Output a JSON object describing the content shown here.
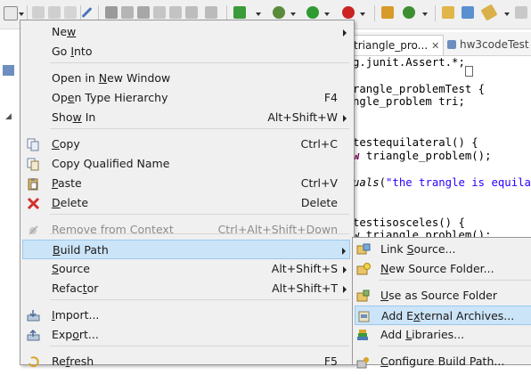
{
  "toolbar": {
    "icons": [
      "new-wizard-icon",
      "save-icon",
      "save-all-icon",
      "print-icon",
      "skip-breakpoints-icon",
      "toggle-breakpoint-icon",
      "step-icon",
      "debug-step-icon",
      "run-step-icon",
      "drop-frame-icon",
      "external-tools-icon",
      "debug-icon",
      "run-icon",
      "run-stop-icon",
      "new-java-package-icon",
      "new-java-class-icon",
      "open-type-icon",
      "search-icon",
      "refactor-icon"
    ]
  },
  "editor": {
    "tabs": [
      {
        "label": "triangle_pro...",
        "close": "✕"
      },
      {
        "label": "hw3codeTest"
      }
    ],
    "code_lines": [
      {
        "parts": [
          {
            "t": "g.junit.Assert.*;",
            "c": ""
          },
          {
            "t": "□",
            "c": ""
          }
        ]
      },
      {
        "parts": [
          {
            "t": "rangle_problemTest {",
            "c": ""
          }
        ]
      },
      {
        "parts": [
          {
            "t": "ngle_problem tri;",
            "c": ""
          }
        ]
      },
      {
        "parts": [
          {
            "t": "testequilateral() {",
            "c": ""
          }
        ]
      },
      {
        "parts": [
          {
            "t": "w ",
            "c": "kw"
          },
          {
            "t": "triangle_problem();",
            "c": ""
          }
        ]
      },
      {
        "parts": [
          {
            "t": "uals",
            "c": "it"
          },
          {
            "t": "(",
            "c": ""
          },
          {
            "t": "\"the trangle is equilate",
            "c": "str"
          }
        ]
      },
      {
        "parts": [
          {
            "t": "testisosceles() {",
            "c": ""
          }
        ]
      },
      {
        "parts": [
          {
            "t": "w triangle_problem();",
            "c": ""
          }
        ]
      }
    ]
  },
  "context_menu": {
    "items": [
      {
        "label": "New",
        "mn": "w",
        "shortcut": "",
        "submenu": true,
        "icon": ""
      },
      {
        "label": "Go Into",
        "mn": "I",
        "shortcut": "",
        "icon": ""
      },
      {
        "label": "Open in New Window",
        "mn": "N",
        "shortcut": "",
        "icon": ""
      },
      {
        "label": "Open Type Hierarchy",
        "mn": "e",
        "shortcut": "F4",
        "icon": ""
      },
      {
        "label": "Show In",
        "mn": "w",
        "shortcut": "Alt+Shift+W",
        "submenu": true,
        "icon": ""
      },
      {
        "label": "Copy",
        "mn": "C",
        "shortcut": "Ctrl+C",
        "icon": "copy-icon"
      },
      {
        "label": "Copy Qualified Name",
        "mn": "",
        "shortcut": "",
        "icon": "copy-qualified-name-icon"
      },
      {
        "label": "Paste",
        "mn": "P",
        "shortcut": "Ctrl+V",
        "icon": "paste-icon"
      },
      {
        "label": "Delete",
        "mn": "D",
        "shortcut": "Delete",
        "icon": "delete-icon"
      },
      {
        "label": "Remove from Context",
        "mn": "",
        "shortcut": "Ctrl+Alt+Shift+Down",
        "disabled": true,
        "icon": "remove-from-context-icon"
      },
      {
        "label": "Build Path",
        "mn": "B",
        "shortcut": "",
        "submenu": true,
        "highlighted": true,
        "icon": ""
      },
      {
        "label": "Source",
        "mn": "S",
        "shortcut": "Alt+Shift+S",
        "submenu": true,
        "icon": ""
      },
      {
        "label": "Refactor",
        "mn": "t",
        "shortcut": "Alt+Shift+T",
        "submenu": true,
        "icon": ""
      },
      {
        "label": "Import...",
        "mn": "I",
        "shortcut": "",
        "icon": "import-icon"
      },
      {
        "label": "Export...",
        "mn": "o",
        "shortcut": "",
        "icon": "export-icon"
      },
      {
        "label": "Refresh",
        "mn": "f",
        "shortcut": "F5",
        "icon": "refresh-icon"
      }
    ]
  },
  "build_path_submenu": {
    "items": [
      {
        "label": "Link Source...",
        "mn": "S",
        "icon": "link-source-icon"
      },
      {
        "label": "New Source Folder...",
        "mn": "N",
        "icon": "new-source-folder-icon"
      },
      {
        "label": "Use as Source Folder",
        "mn": "U",
        "icon": "use-as-source-folder-icon"
      },
      {
        "label": "Add External Archives...",
        "mn": "x",
        "highlighted": true,
        "icon": "add-external-archives-icon"
      },
      {
        "label": "Add Libraries...",
        "mn": "L",
        "icon": "add-libraries-icon"
      },
      {
        "label": "Configure Build Path...",
        "mn": "C",
        "icon": "configure-build-path-icon"
      }
    ]
  },
  "colors": {
    "highlight": "#cce4f7",
    "highlight_border": "#99c9ef",
    "menu_bg": "#f0f0f0",
    "keyword": "#7f0055",
    "string": "#2a00ff"
  }
}
